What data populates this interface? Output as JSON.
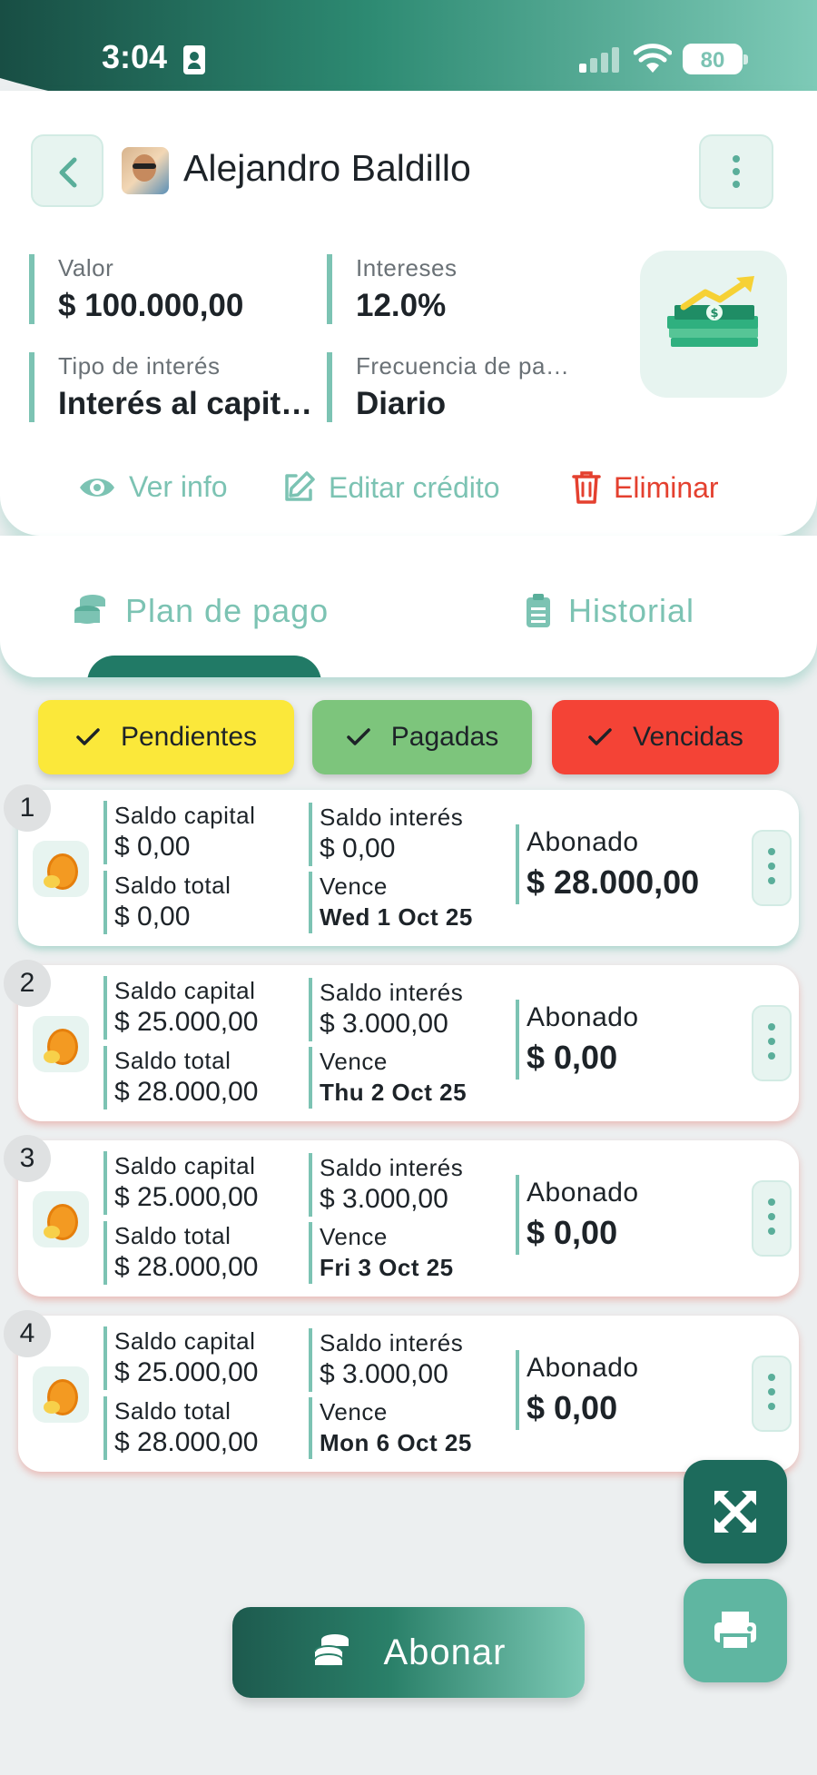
{
  "status_bar": {
    "time": "3:04",
    "battery": "80"
  },
  "header": {
    "client_name": "Alejandro Baldillo",
    "fields": {
      "valor_label": "Valor",
      "valor_value": "$ 100.000,00",
      "intereses_label": "Intereses",
      "intereses_value": "12.0%",
      "tipo_label": "Tipo de interés",
      "tipo_value": "Interés al capit…",
      "frecuencia_label": "Frecuencia de pa…",
      "frecuencia_value": "Diario"
    },
    "actions": {
      "ver_info": "Ver info",
      "editar": "Editar crédito",
      "eliminar": "Eliminar"
    }
  },
  "tabs": [
    {
      "label": "Plan de pago",
      "active": true
    },
    {
      "label": "Historial",
      "active": false
    }
  ],
  "filters": [
    {
      "label": "Pendientes",
      "color": "#fbe83a"
    },
    {
      "label": "Pagadas",
      "color": "#7dc57c"
    },
    {
      "label": "Vencidas",
      "color": "#f44336"
    }
  ],
  "payments": [
    {
      "num": "1",
      "saldo_capital_label": "Saldo capital",
      "saldo_capital": "$ 0,00",
      "saldo_total_label": "Saldo total",
      "saldo_total": "$ 0,00",
      "saldo_interes_label": "Saldo interés",
      "saldo_interes": "$ 0,00",
      "vence_label": "Vence",
      "vence": "Wed 1 Oct 25",
      "abonado_label": "Abonado",
      "abonado": "$ 28.000,00"
    },
    {
      "num": "2",
      "saldo_capital_label": "Saldo capital",
      "saldo_capital": "$ 25.000,00",
      "saldo_total_label": "Saldo total",
      "saldo_total": "$ 28.000,00",
      "saldo_interes_label": "Saldo interés",
      "saldo_interes": "$ 3.000,00",
      "vence_label": "Vence",
      "vence": "Thu 2 Oct 25",
      "abonado_label": "Abonado",
      "abonado": "$ 0,00"
    },
    {
      "num": "3",
      "saldo_capital_label": "Saldo capital",
      "saldo_capital": "$ 25.000,00",
      "saldo_total_label": "Saldo total",
      "saldo_total": "$ 28.000,00",
      "saldo_interes_label": "Saldo interés",
      "saldo_interes": "$ 3.000,00",
      "vence_label": "Vence",
      "vence": "Fri 3 Oct 25",
      "abonado_label": "Abonado",
      "abonado": "$ 0,00"
    },
    {
      "num": "4",
      "saldo_capital_label": "Saldo capital",
      "saldo_capital": "$ 25.000,00",
      "saldo_total_label": "Saldo total",
      "saldo_total": "$ 28.000,00",
      "saldo_interes_label": "Saldo interés",
      "saldo_interes": "$ 3.000,00",
      "vence_label": "Vence",
      "vence": "Mon 6 Oct 25",
      "abonado_label": "Abonado",
      "abonado": "$ 0,00"
    }
  ],
  "buttons": {
    "abonar": "Abonar"
  },
  "colors": {
    "accent": "#7cc3b3",
    "accent_dark": "#1d6b5c",
    "danger": "#e4402f",
    "background": "#eceff0"
  }
}
